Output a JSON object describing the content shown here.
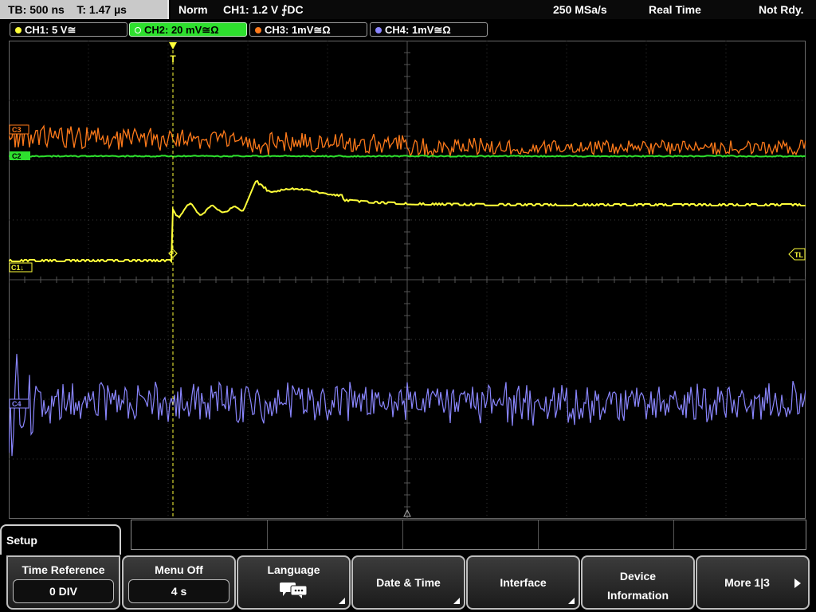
{
  "status": {
    "timebase": "TB: 500 ns",
    "trigger_time": "T: 1.47 µs",
    "mode": "Norm",
    "trigger_info": "CH1: 1.2 V ⨍DC",
    "sample_rate": "250 MSa/s",
    "acq_mode": "Real Time",
    "state": "Not Rdy."
  },
  "channels": [
    {
      "label": "CH1: 5 V≅",
      "color": "#ffff3a",
      "active": false
    },
    {
      "label": "CH2: 20 mV≅Ω",
      "color": "#2ee02e",
      "active": true
    },
    {
      "label": "CH3: 1mV≅Ω",
      "color": "#ff7a1a",
      "active": false
    },
    {
      "label": "CH4: 1mV≅Ω",
      "color": "#8a86ff",
      "active": false
    }
  ],
  "markers": {
    "c1": "C1↓",
    "c2": "C2",
    "c3": "C3",
    "c4": "C4",
    "trigger_level": "TL",
    "trigger_top": "T"
  },
  "menu": {
    "title": "Setup",
    "softkeys": [
      {
        "label": "Time Reference",
        "value": "0 DIV"
      },
      {
        "label": "Menu Off",
        "value": "4 s"
      },
      {
        "label": "Language",
        "value": "",
        "icon": "speech-bubbles-icon"
      },
      {
        "label": "Date & Time"
      },
      {
        "label": "Interface"
      },
      {
        "label": "Device Information"
      },
      {
        "label": "More 1|3"
      }
    ]
  }
}
